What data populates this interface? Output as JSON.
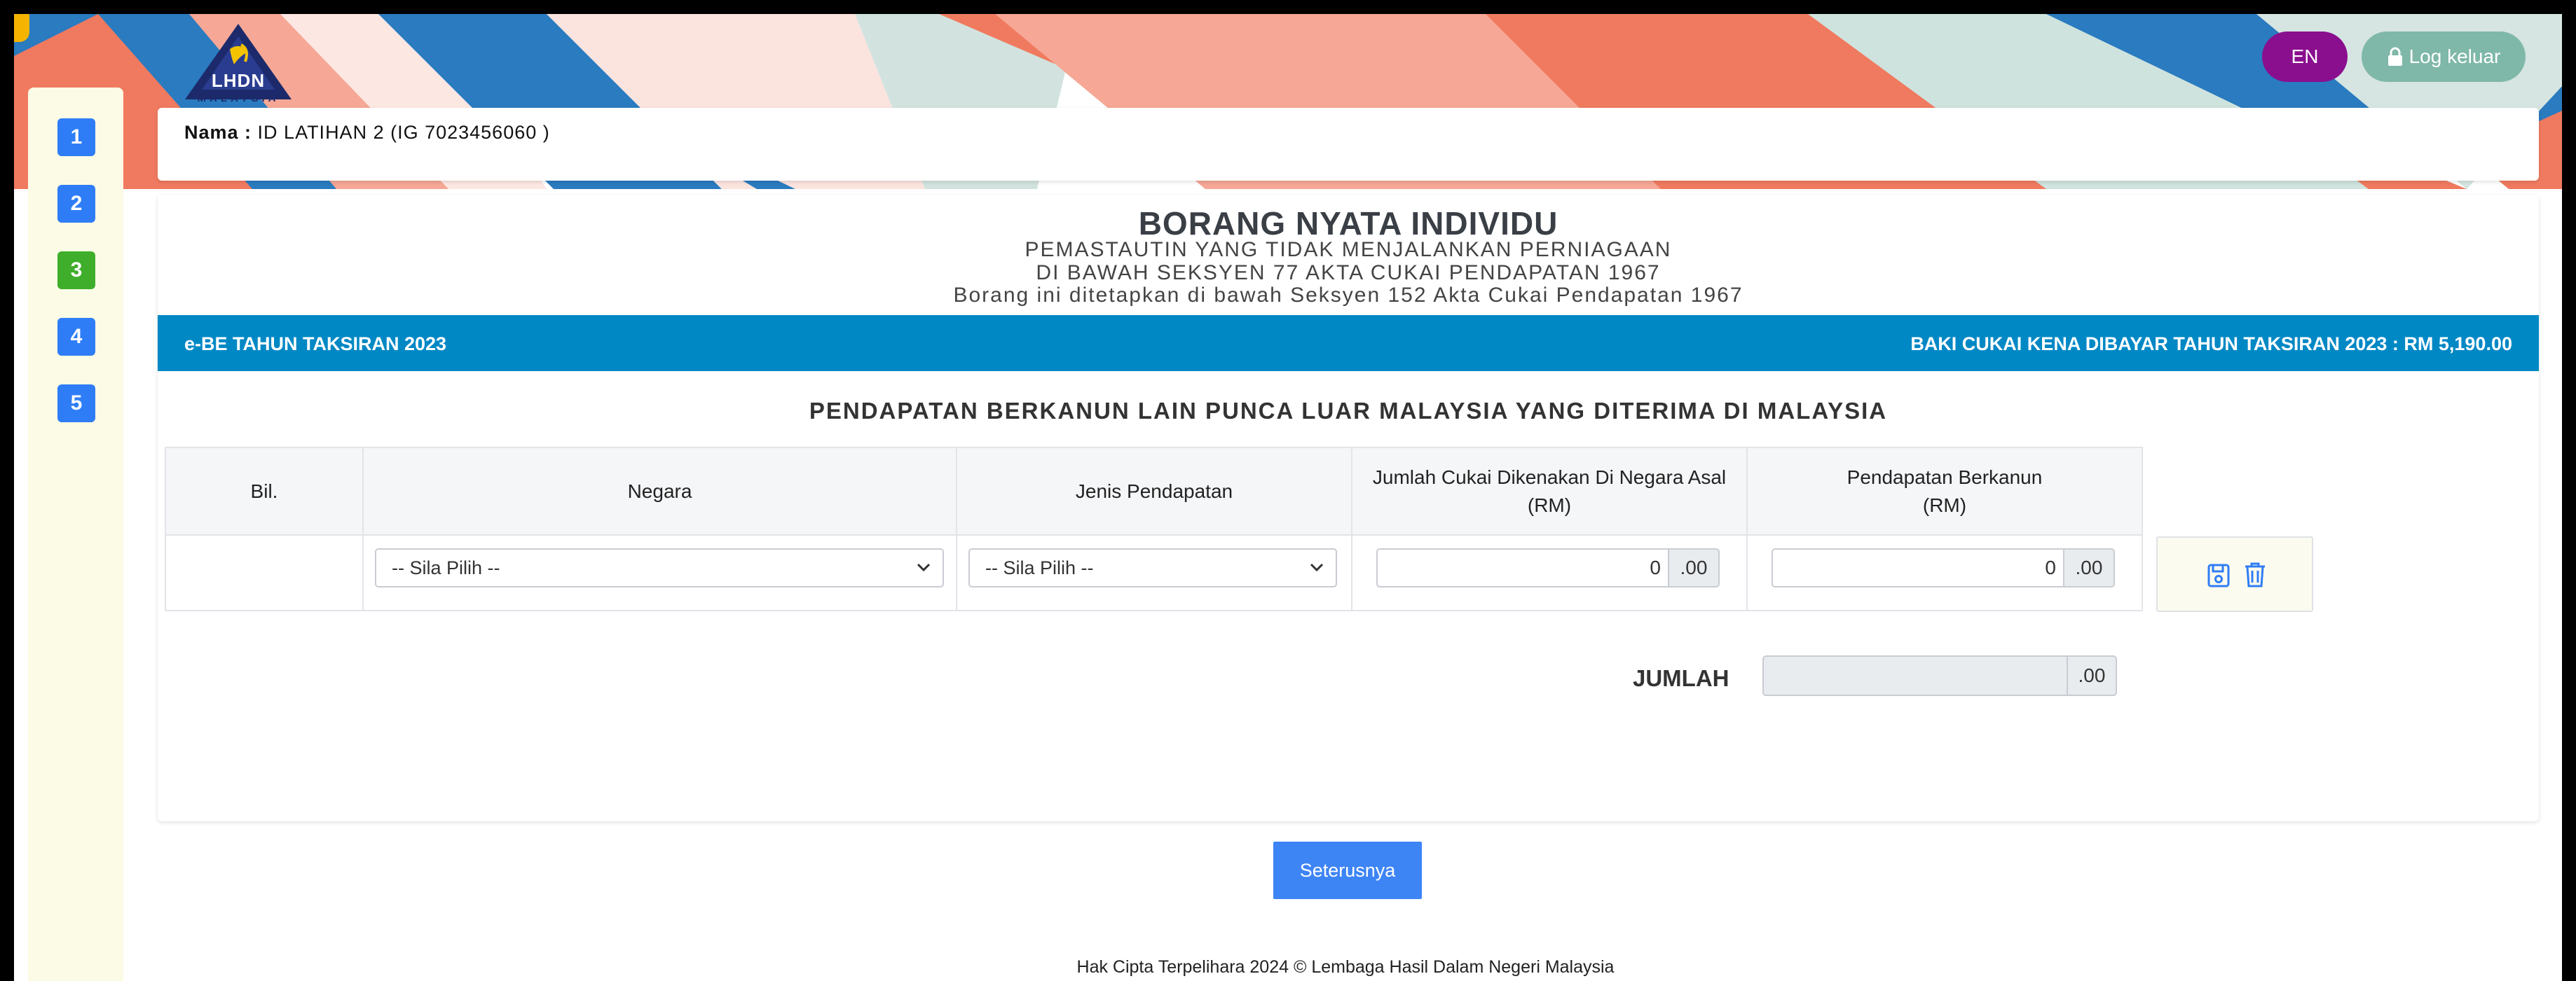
{
  "header": {
    "logo_text": "LHDN",
    "logo_subtext": "MALAYSIA",
    "lang_button": "EN",
    "logout_button": "Log keluar"
  },
  "sidebar": {
    "steps": [
      "1",
      "2",
      "3",
      "4",
      "5"
    ],
    "active_step": "3"
  },
  "profile": {
    "name_label": "Nama :",
    "name_value": "ID LATIHAN 2 (IG 7023456060 )"
  },
  "form": {
    "title": "BORANG NYATA INDIVIDU",
    "subtitle1": "PEMASTAUTIN YANG TIDAK MENJALANKAN PERNIAGAAN",
    "subtitle2": "DI BAWAH SEKSYEN 77 AKTA CUKAI PENDAPATAN 1967",
    "subtitle3": "Borang ini ditetapkan di bawah Seksyen 152 Akta Cukai Pendapatan 1967",
    "bar_left": "e-BE TAHUN TAKSIRAN 2023",
    "bar_right": "BAKI CUKAI KENA DIBAYAR TAHUN TAKSIRAN 2023 : RM 5,190.00",
    "section_title": "PENDAPATAN BERKANUN LAIN PUNCA LUAR MALAYSIA YANG DITERIMA DI MALAYSIA"
  },
  "table": {
    "columns": {
      "bil": "Bil.",
      "negara": "Negara",
      "jenis": "Jenis Pendapatan",
      "cukai_line1": "Jumlah Cukai Dikenakan Di Negara Asal",
      "cukai_line2": "(RM)",
      "pendapatan_line1": "Pendapatan Berkanun",
      "pendapatan_line2": "(RM)"
    },
    "row": {
      "bil": "",
      "negara": "-- Sila Pilih --",
      "jenis": "-- Sila Pilih --",
      "cukai_value": "0",
      "cukai_cents": ".00",
      "pendapatan_value": "0",
      "pendapatan_cents": ".00"
    }
  },
  "total": {
    "label": "JUMLAH",
    "value": "",
    "cents": ".00"
  },
  "buttons": {
    "next": "Seterusnya"
  },
  "footer": {
    "text": "Hak Cipta Terpelihara 2024 © Lembaga Hasil Dalam Negeri Malaysia"
  },
  "colors": {
    "blue_bar": "#0088c5",
    "step_blue": "#2f7df6",
    "step_green": "#3fae2a",
    "lang_button": "#8a0f8f",
    "logout_button": "#7fb8a8",
    "next_button": "#3d84f5",
    "icon_blue": "#2f7df6"
  },
  "icons": {
    "save": "save-icon",
    "delete": "trash-icon",
    "lock": "lock-icon",
    "dropdown": "chevron-down-icon"
  }
}
